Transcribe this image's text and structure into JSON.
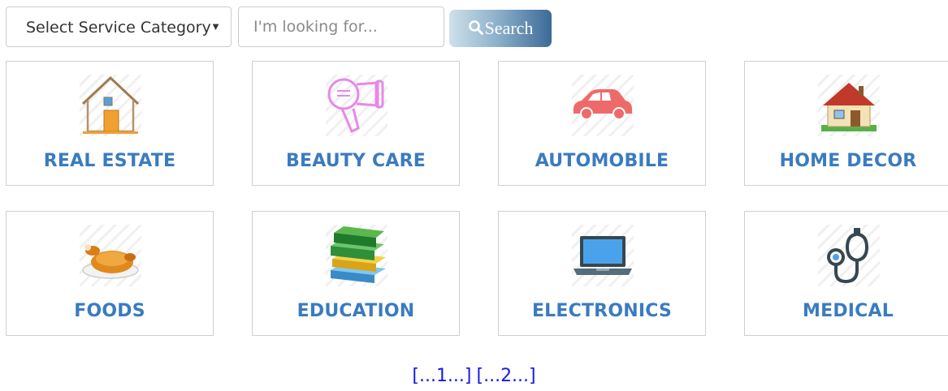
{
  "search": {
    "category_selected": "Select Service Category",
    "caret": "▼",
    "input_placeholder": "I'm looking for...",
    "button_label": "Search"
  },
  "categories": [
    {
      "label": "REAL ESTATE",
      "icon": "house-icon"
    },
    {
      "label": "BEAUTY CARE",
      "icon": "hair-dryer-icon"
    },
    {
      "label": "AUTOMOBILE",
      "icon": "car-icon"
    },
    {
      "label": "HOME DECOR",
      "icon": "home-decor-icon"
    },
    {
      "label": "FOODS",
      "icon": "roast-chicken-icon"
    },
    {
      "label": "EDUCATION",
      "icon": "books-icon"
    },
    {
      "label": "ELECTRONICS",
      "icon": "laptop-icon"
    },
    {
      "label": "MEDICAL",
      "icon": "stethoscope-icon"
    }
  ],
  "pagination": [
    "[...1...]",
    "[...2...]"
  ],
  "colors": {
    "label_blue": "#3a7bc0",
    "pager_link": "#1a1adc",
    "button_dark": "#3c6a98"
  }
}
